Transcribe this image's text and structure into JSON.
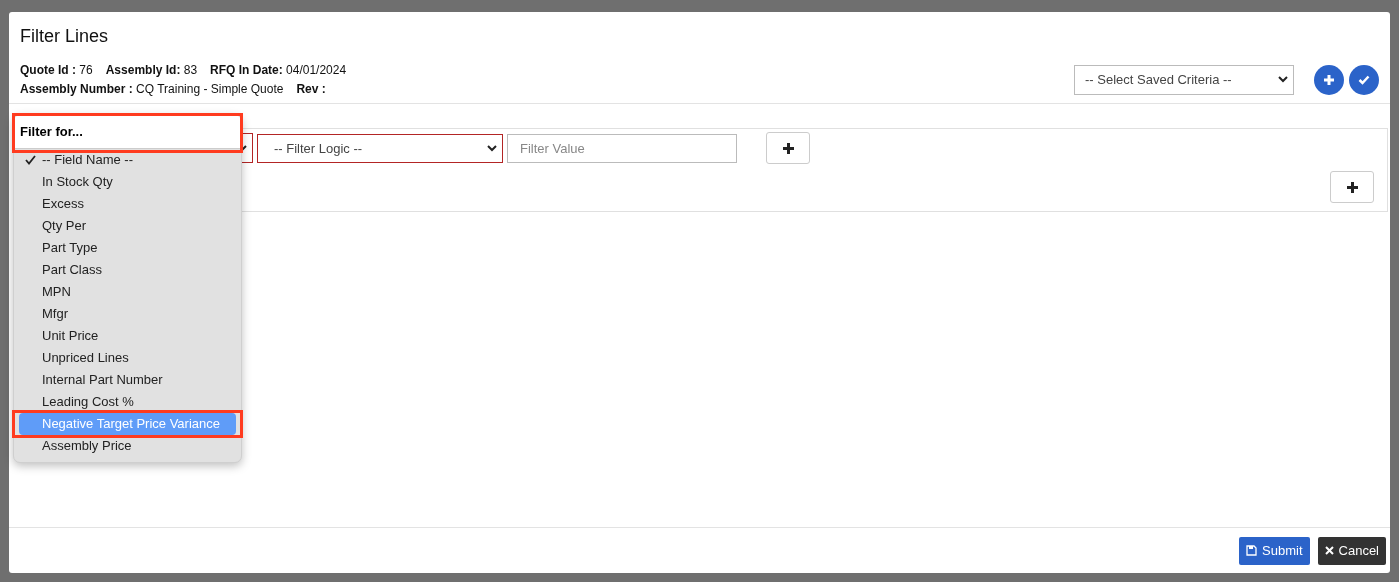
{
  "dialog": {
    "title": "Filter Lines",
    "info": [
      [
        {
          "label": "Quote Id :",
          "value": "76"
        },
        {
          "label": "Assembly Id:",
          "value": "83"
        },
        {
          "label": "RFQ In Date:",
          "value": "04/01/2024"
        }
      ],
      [
        {
          "label": "Assembly Number :",
          "value": "CQ Training - Simple Quote"
        },
        {
          "label": "Rev :"
        }
      ]
    ],
    "saved_criteria": {
      "placeholder": "-- Select Saved Criteria --"
    },
    "toolbar_buttons": [
      {
        "kind": "add"
      },
      {
        "kind": "apply"
      }
    ],
    "filter_row": {
      "logic": "-- Filter Logic --",
      "value_placeholder": "Filter Value",
      "invalid": true
    },
    "dropdown": {
      "search_placeholder": "Filter for...",
      "search_annotated": true,
      "options": [
        {
          "label": "-- Field Name --",
          "checked": true,
          "selected": false,
          "annotated": false
        },
        {
          "label": "In Stock Qty",
          "checked": false,
          "selected": false,
          "annotated": false
        },
        {
          "label": "Excess",
          "checked": false,
          "selected": false,
          "annotated": false
        },
        {
          "label": "Qty Per",
          "checked": false,
          "selected": false,
          "annotated": false
        },
        {
          "label": "Part Type",
          "checked": false,
          "selected": false,
          "annotated": false
        },
        {
          "label": "Part Class",
          "checked": false,
          "selected": false,
          "annotated": false
        },
        {
          "label": "MPN",
          "checked": false,
          "selected": false,
          "annotated": false
        },
        {
          "label": "Mfgr",
          "checked": false,
          "selected": false,
          "annotated": false
        },
        {
          "label": "Unit Price",
          "checked": false,
          "selected": false,
          "annotated": false
        },
        {
          "label": "Unpriced Lines",
          "checked": false,
          "selected": false,
          "annotated": false
        },
        {
          "label": "Internal Part Number",
          "checked": false,
          "selected": false,
          "annotated": false
        },
        {
          "label": "Leading Cost %",
          "checked": false,
          "selected": false,
          "annotated": false
        },
        {
          "label": "Negative Target Price Variance",
          "checked": false,
          "selected": true,
          "annotated": true
        },
        {
          "label": "Assembly Price",
          "checked": false,
          "selected": false,
          "annotated": false
        }
      ]
    },
    "footer": {
      "submit": "Submit",
      "cancel": "Cancel"
    }
  }
}
